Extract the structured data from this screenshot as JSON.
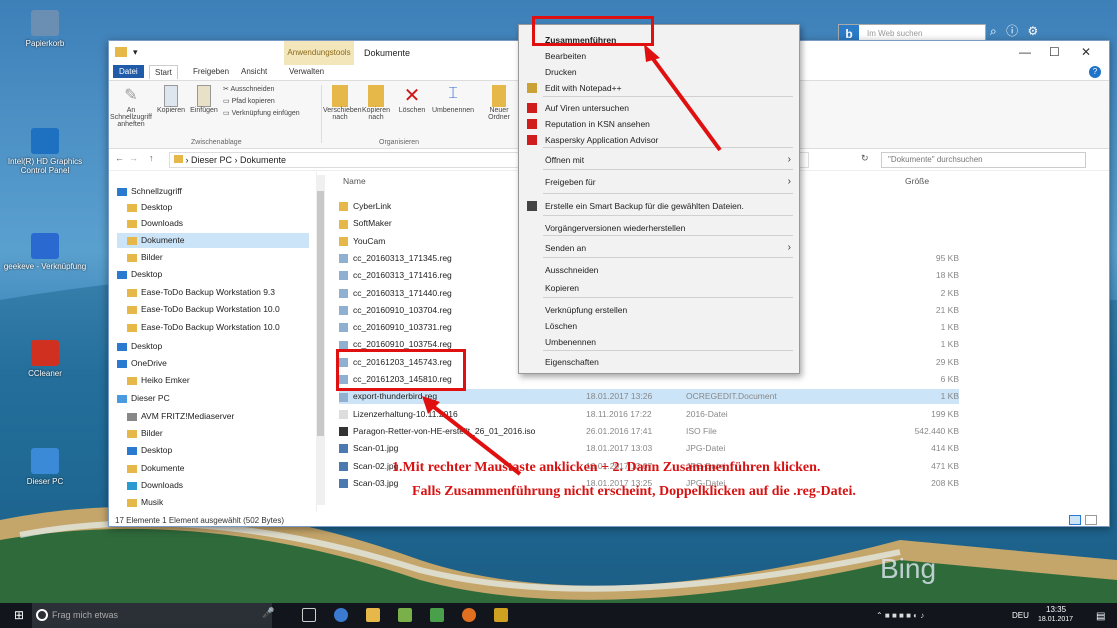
{
  "desktop": {
    "icons": [
      {
        "label": "Papierkorb",
        "color": "#6a8fb3"
      },
      {
        "label": "Intel(R) HD Graphics Control Panel",
        "color": "#1e70c0"
      },
      {
        "label": "geekeve - Verknüpfung",
        "color": "#2a6ad0"
      },
      {
        "label": "CCleaner",
        "color": "#d03020"
      },
      {
        "label": "Dieser PC",
        "color": "#3a8ad8"
      }
    ],
    "bing_search_placeholder": "Im Web suchen",
    "bing_watermark": "Bing"
  },
  "window": {
    "context_tab": "Anwendungstools",
    "title": "Dokumente",
    "ribbon_tabs": [
      "Datei",
      "Start",
      "Freigeben",
      "Ansicht",
      "Verwalten"
    ],
    "ribbon": {
      "pin": "An Schnellzugriff anheften",
      "copy": "Kopieren",
      "paste": "Einfügen",
      "cut": "Ausschneiden",
      "copy_path": "Pfad kopieren",
      "paste_link": "Verknüpfung einfügen",
      "group_clipboard": "Zwischenablage",
      "move": "Verschieben nach",
      "copy_to": "Kopieren nach",
      "delete": "Löschen",
      "rename": "Umbenennen",
      "group_organize": "Organisieren",
      "new": "Neuer Ordner"
    },
    "address": {
      "crumb1": "Dieser PC",
      "crumb2": "Dokumente",
      "search_placeholder": "\"Dokumente\" durchsuchen"
    },
    "nav": [
      {
        "label": "Schnellzugriff",
        "color": "#2a7ad0",
        "highlight": false
      },
      {
        "label": "Desktop",
        "color": "#e6b84a",
        "highlight": false
      },
      {
        "label": "Downloads",
        "color": "#e6b84a",
        "highlight": false
      },
      {
        "label": "Dokumente",
        "color": "#e6b84a",
        "highlight": true
      },
      {
        "label": "Bilder",
        "color": "#e6b84a",
        "highlight": false
      },
      {
        "label": "Desktop",
        "color": "#2a7ad0",
        "highlight": false
      },
      {
        "label": "Ease-ToDo Backup Workstation 9.3",
        "color": "#e6b84a",
        "highlight": false
      },
      {
        "label": "Ease-ToDo Backup Workstation 10.0",
        "color": "#e6b84a",
        "highlight": false
      },
      {
        "label": "Ease-ToDo Backup Workstation 10.0",
        "color": "#e6b84a",
        "highlight": false
      },
      {
        "label": "Desktop",
        "color": "#2a7ad0",
        "highlight": false
      },
      {
        "label": "OneDrive",
        "color": "#2a7ad0",
        "highlight": false
      },
      {
        "label": "Heiko Emker",
        "color": "#e6b84a",
        "highlight": false
      },
      {
        "label": "Dieser PC",
        "color": "#4a9ae0",
        "highlight": false
      },
      {
        "label": "AVM FRITZ!Mediaserver",
        "color": "#888888",
        "highlight": false
      },
      {
        "label": "Bilder",
        "color": "#e6b84a",
        "highlight": false
      },
      {
        "label": "Desktop",
        "color": "#2a7ad0",
        "highlight": false
      },
      {
        "label": "Dokumente",
        "color": "#e6b84a",
        "highlight": false
      },
      {
        "label": "Downloads",
        "color": "#2a9ad0",
        "highlight": false
      },
      {
        "label": "Musik",
        "color": "#e6b84a",
        "highlight": false
      }
    ],
    "columns": {
      "name": "Name",
      "size": "Größe"
    },
    "files": [
      {
        "name": "CyberLink",
        "date": "",
        "type": "",
        "size": "",
        "color": "#e6b84a",
        "sel": false
      },
      {
        "name": "SoftMaker",
        "date": "",
        "type": "",
        "size": "",
        "color": "#e6b84a",
        "sel": false
      },
      {
        "name": "YouCam",
        "date": "",
        "type": "",
        "size": "",
        "color": "#e6b84a",
        "sel": false
      },
      {
        "name": "cc_20160313_171345.reg",
        "date": "",
        "type": "",
        "size": "95 KB",
        "color": "#8fb0d0",
        "sel": false
      },
      {
        "name": "cc_20160313_171416.reg",
        "date": "",
        "type": "",
        "size": "18 KB",
        "color": "#8fb0d0",
        "sel": false
      },
      {
        "name": "cc_20160313_171440.reg",
        "date": "",
        "type": "",
        "size": "2 KB",
        "color": "#8fb0d0",
        "sel": false
      },
      {
        "name": "cc_20160910_103704.reg",
        "date": "",
        "type": "",
        "size": "21 KB",
        "color": "#8fb0d0",
        "sel": false
      },
      {
        "name": "cc_20160910_103731.reg",
        "date": "",
        "type": "",
        "size": "1 KB",
        "color": "#8fb0d0",
        "sel": false
      },
      {
        "name": "cc_20160910_103754.reg",
        "date": "",
        "type": "",
        "size": "1 KB",
        "color": "#8fb0d0",
        "sel": false
      },
      {
        "name": "cc_20161203_145743.reg",
        "date": "",
        "type": "",
        "size": "29 KB",
        "color": "#8fb0d0",
        "sel": false
      },
      {
        "name": "cc_20161203_145810.reg",
        "date": "",
        "type": "",
        "size": "6 KB",
        "color": "#8fb0d0",
        "sel": false
      },
      {
        "name": "export-thunderbird.reg",
        "date": "18.01.2017 13:26",
        "type": "OCREGEDIT.Document",
        "size": "1 KB",
        "color": "#8fb0d0",
        "sel": true
      },
      {
        "name": "Lizenzerhaltung-10.11.2016",
        "date": "18.11.2016 17:22",
        "type": "2016-Datei",
        "size": "199 KB",
        "color": "#dddddd",
        "sel": false
      },
      {
        "name": "Paragon-Retter-von-HE-erstellt_26_01_2016.iso",
        "date": "26.01.2016 17:41",
        "type": "ISO File",
        "size": "542.440 KB",
        "color": "#333333",
        "sel": false
      },
      {
        "name": "Scan-01.jpg",
        "date": "18.01.2017 13:03",
        "type": "JPG-Datei",
        "size": "414 KB",
        "color": "#4a7ab0",
        "sel": false
      },
      {
        "name": "Scan-02.jpg",
        "date": "18.01.2017 13:07",
        "type": "JPG-Datei",
        "size": "471 KB",
        "color": "#4a7ab0",
        "sel": false
      },
      {
        "name": "Scan-03.jpg",
        "date": "18.01.2017 13:25",
        "type": "JPG-Datei",
        "size": "208 KB",
        "color": "#4a7ab0",
        "sel": false
      }
    ],
    "status": "17 Elemente    1 Element ausgewählt (502 Bytes)"
  },
  "context_menu": [
    {
      "label": "Zusammenführen",
      "bold": true,
      "icon": ""
    },
    {
      "label": "Bearbeiten",
      "bold": false,
      "icon": ""
    },
    {
      "label": "Drucken",
      "bold": false,
      "icon": ""
    },
    {
      "label": "Edit with Notepad++",
      "bold": false,
      "icon": "notepad-icon"
    },
    {
      "label": "Auf Viren untersuchen",
      "bold": false,
      "icon": "kaspersky-icon"
    },
    {
      "label": "Reputation in KSN ansehen",
      "bold": false,
      "icon": "kaspersky-icon"
    },
    {
      "label": "Kaspersky Application Advisor",
      "bold": false,
      "icon": "kaspersky-icon"
    },
    {
      "label": "Öffnen mit",
      "bold": false,
      "icon": "",
      "submenu": true
    },
    {
      "label": "Freigeben für",
      "bold": false,
      "icon": "",
      "submenu": true
    },
    {
      "label": "Erstelle ein Smart Backup für die gewählten Dateien.",
      "bold": false,
      "icon": "backup-icon"
    },
    {
      "label": "Vorgängerversionen wiederherstellen",
      "bold": false,
      "icon": ""
    },
    {
      "label": "Senden an",
      "bold": false,
      "icon": "",
      "submenu": true
    },
    {
      "label": "Ausschneiden",
      "bold": false,
      "icon": ""
    },
    {
      "label": "Kopieren",
      "bold": false,
      "icon": ""
    },
    {
      "label": "Verknüpfung erstellen",
      "bold": false,
      "icon": ""
    },
    {
      "label": "Löschen",
      "bold": false,
      "icon": ""
    },
    {
      "label": "Umbenennen",
      "bold": false,
      "icon": ""
    },
    {
      "label": "Eigenschaften",
      "bold": false,
      "icon": ""
    }
  ],
  "annotations": {
    "line1": "1.Mit rechter Maustaste anklicken + 2. Dann Zusammenführen klicken.",
    "line2": "Falls Zusammenführung nicht erscheint, Doppelklicken auf die .reg-Datei."
  },
  "taskbar": {
    "search_placeholder": "Frag mich etwas",
    "language": "DEU",
    "time": "13:35",
    "date": "18.01.2017"
  },
  "colors": {
    "accent": "#1f5ba8",
    "annotation": "#e01010",
    "selection": "#cce4f7"
  }
}
